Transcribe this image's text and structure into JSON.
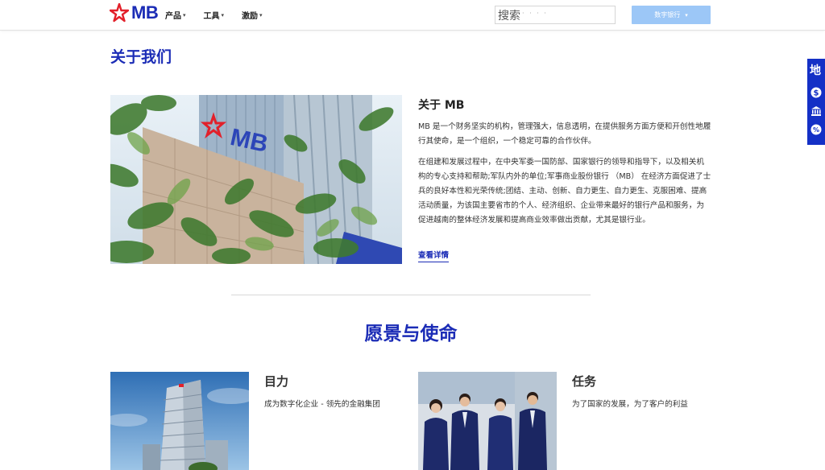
{
  "header": {
    "logo_text": "MB",
    "nav": [
      {
        "label": "产品"
      },
      {
        "label": "工具"
      },
      {
        "label": "激励"
      }
    ],
    "search_placeholder": "搜索",
    "digital_bank_label": "数字银行"
  },
  "side_toolbar": {
    "label": "地",
    "icons": [
      "dollar-coin-icon",
      "bank-icon",
      "percent-icon"
    ]
  },
  "about": {
    "section_title": "关于我们",
    "title": "关于 MB",
    "paragraph1": "MB 是一个财务坚实的机构，管理强大，信息透明，在提供服务方面方便和开创性地履行其使命，是一个组织，一个稳定可靠的合作伙伴。",
    "paragraph2": "在组建和发展过程中，在中央军委一国防部、国家银行的领导和指导下，以及相关机构的专心支持和帮助;军队内外的单位;军事商业股份银行 （MB） 在经济方面促进了士兵的良好本性和光荣传统;团结、主动、创新、自力更生、自力更生、克服困难、提高活动质量，为该国主要省市的个人、经济组织、企业带来最好的银行产品和服务，为促进越南的整体经济发展和提高商业效率做出贡献，尤其是银行业。",
    "more_link": "查看详情",
    "image_logo_text": "MB"
  },
  "vision": {
    "section_title": "愿景与使命",
    "cards": [
      {
        "title": "目力",
        "text": "成为数字化企业 - 领先的金融集团"
      },
      {
        "title": "任务",
        "text": "为了国家的发展，为了客户的利益"
      }
    ]
  },
  "colors": {
    "brand_blue": "#1b2cb6",
    "brand_red": "#e2202a",
    "button_light_blue": "#9cc7f7",
    "side_toolbar_blue": "#1430c6"
  }
}
